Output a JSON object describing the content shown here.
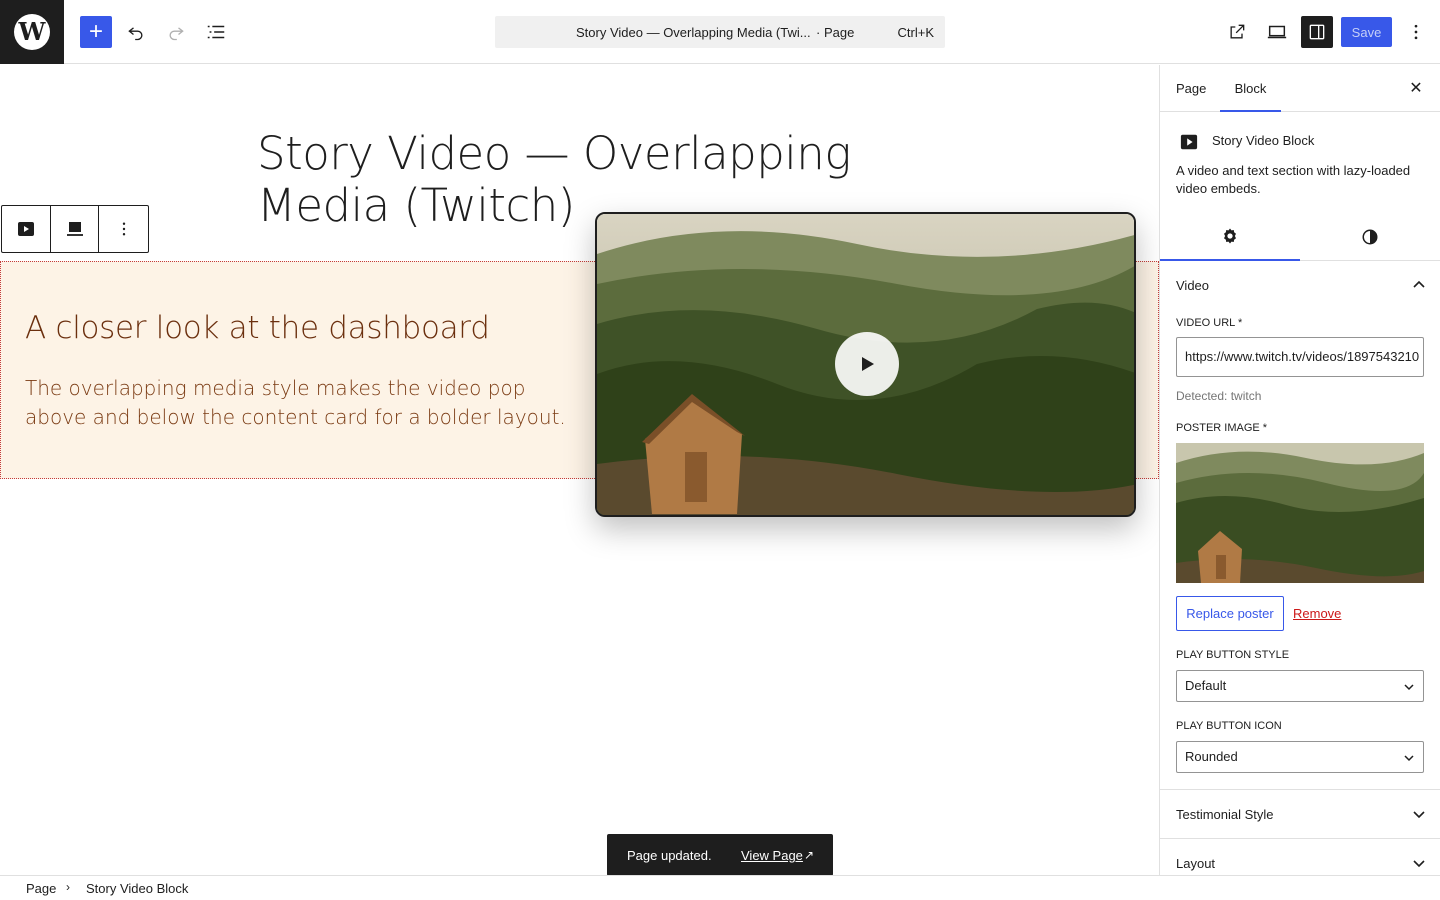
{
  "topbar": {
    "logo_letter": "W",
    "add_label": "+",
    "title": "Story Video — Overlapping Media (Twi...",
    "type": "· Page",
    "shortcut": "Ctrl+K",
    "save_label": "Save"
  },
  "canvas": {
    "post_title": "Story Video — Overlapping Media (Twitch)",
    "story_heading": "A closer look at the dashboard",
    "story_text": "The overlapping media style makes the video pop above and below the content card for a bolder layout."
  },
  "snackbar": {
    "message": "Page updated.",
    "link": "View Page",
    "arrow": "↗"
  },
  "breadcrumb": {
    "root": "Page",
    "separator": "›",
    "current": "Story Video Block"
  },
  "sidebar": {
    "tabs": {
      "page": "Page",
      "block": "Block"
    },
    "close": "✕",
    "block_card": {
      "title": "Story Video Block",
      "description": "A video and text section with lazy-loaded video embeds."
    },
    "video_panel": {
      "title": "Video",
      "url_label": "VIDEO URL *",
      "url_value": "https://www.twitch.tv/videos/1897543210",
      "detected": "Detected: twitch",
      "poster_label": "POSTER IMAGE *",
      "replace_label": "Replace poster",
      "remove_label": "Remove",
      "play_style_label": "PLAY BUTTON STYLE",
      "play_style_value": "Default",
      "play_icon_label": "PLAY BUTTON ICON",
      "play_icon_value": "Rounded"
    },
    "testimonial_panel": {
      "title": "Testimonial Style"
    },
    "layout_panel": {
      "title": "Layout"
    }
  },
  "colors": {
    "accent": "#3858e9",
    "story_bg": "#fdf3e6",
    "story_heading": "#6b2f0e",
    "remove": "#cc1818"
  },
  "icons": {
    "logo": "wordpress-icon",
    "undo": "undo-icon",
    "redo": "redo-icon",
    "list_view": "list-view-icon",
    "view_page": "external-link-icon",
    "preview": "desktop-preview-icon",
    "settings": "gear-icon",
    "styles": "half-circle-icon",
    "play": "play-icon"
  }
}
